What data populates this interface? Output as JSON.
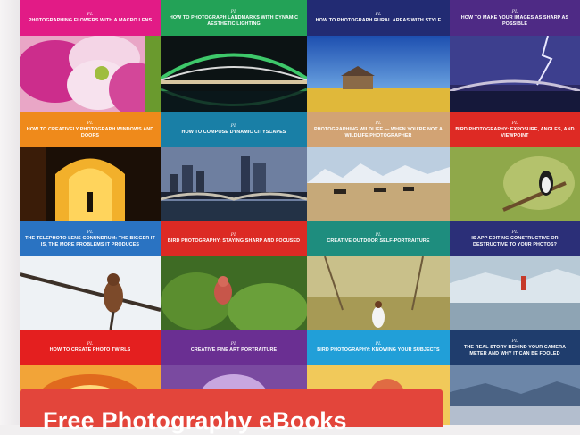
{
  "cards": [
    {
      "title": "Photographing Flowers with a Macro Lens",
      "author": "Photography Life",
      "color": "#e21b86",
      "logo": "PL"
    },
    {
      "title": "How to Photograph Landmarks with Dynamic Aesthetic Lighting",
      "author": "Photography Life",
      "color": "#23a257",
      "logo": "PL"
    },
    {
      "title": "How to Photograph Rural Areas with Style",
      "author": "Photography Life",
      "color": "#222b73",
      "logo": "PL"
    },
    {
      "title": "How to Make Your Images as Sharp as Possible",
      "author": "Photography Life",
      "color": "#4e2a85",
      "logo": "PL"
    },
    {
      "title": "How to Creatively Photograph Windows and Doors",
      "author": "Photography Life",
      "color": "#ef8a1b",
      "logo": "PL"
    },
    {
      "title": "How to Compose Dynamic Cityscapes",
      "author": "Photography Life",
      "color": "#197fa6",
      "logo": "PL"
    },
    {
      "title": "Photographing Wildlife — When You're Not a Wildlife Photographer",
      "author": "Photography Life",
      "color": "#d2a374",
      "logo": "PL"
    },
    {
      "title": "Bird Photography: Exposure, Angles, and Viewpoint",
      "author": "Photography Life",
      "color": "#de2a24",
      "logo": "PL"
    },
    {
      "title": "The Telephoto Lens Conundrum: The Bigger It Is, the More Problems It Produces",
      "author": "Photography Life",
      "color": "#2a73c2",
      "logo": "PL"
    },
    {
      "title": "Bird Photography: Staying Sharp and Focused",
      "author": "Photography Life",
      "color": "#dc2a24",
      "logo": "PL"
    },
    {
      "title": "Creative Outdoor Self-Portraiture",
      "author": "Photography Life",
      "color": "#1e8d7e",
      "logo": "PL"
    },
    {
      "title": "Is App Editing Constructive or Destructive to Your Photos?",
      "author": "Photography Life",
      "color": "#2b2f78",
      "logo": "PL"
    },
    {
      "title": "How to Create Photo Twirls",
      "author": "Photography Life",
      "color": "#e41f1f",
      "logo": "PL"
    },
    {
      "title": "Creative Fine Art Portraiture",
      "author": "Photography Life",
      "color": "#6a2f92",
      "logo": "PL"
    },
    {
      "title": "Bird Photography: Knowing Your Subjects",
      "author": "Photography Life",
      "color": "#219fd8",
      "logo": "PL"
    },
    {
      "title": "The Real Story Behind Your Camera Meter and Why It Can Be Fooled",
      "author": "Photography Life",
      "color": "#1f3d6d",
      "logo": "PL"
    }
  ],
  "cta": {
    "label": "Free Photography eBooks"
  }
}
